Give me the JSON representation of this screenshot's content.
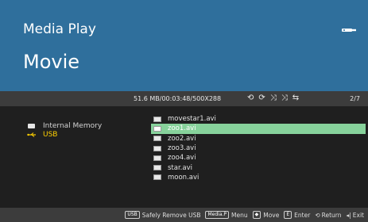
{
  "header": {
    "app_title": "Media Play",
    "section_title": "Movie"
  },
  "infobar": {
    "file_meta": "51.6 MB/00:03:48/500X288",
    "icons": [
      "repeat-one-icon",
      "repeat-all-icon",
      "shuffle-icon",
      "shuffle-all-icon",
      "repeat-off-icon"
    ],
    "page_count": "2/7"
  },
  "devices": [
    {
      "label": "Internal Memory",
      "icon": "memory-icon",
      "selected": false
    },
    {
      "label": "USB",
      "icon": "usb-icon",
      "selected": true
    }
  ],
  "files": [
    {
      "name": "movestar1.avi",
      "selected": false
    },
    {
      "name": "zoo1.avi",
      "selected": true
    },
    {
      "name": "zoo2.avi",
      "selected": false
    },
    {
      "name": "zoo3.avi",
      "selected": false
    },
    {
      "name": "zoo4.avi",
      "selected": false
    },
    {
      "name": "star.avi",
      "selected": false
    },
    {
      "name": "moon.avi",
      "selected": false
    }
  ],
  "footer": {
    "safely_remove": {
      "key": "USB",
      "label": "Safely Remove USB"
    },
    "menu": {
      "key": "Media.P",
      "label": "Menu"
    },
    "move": {
      "key": "◆",
      "label": "Move"
    },
    "enter": {
      "key": "E",
      "label": "Enter"
    },
    "return": {
      "key": "⟲",
      "label": "Return"
    },
    "exit": {
      "key": "◂|",
      "label": "Exit"
    }
  },
  "colors": {
    "header_bg": "#2f6f9c",
    "infobar_bg": "#3c3c3c",
    "content_bg": "#1f1f1f",
    "selected_row": "#87d29b",
    "usb_highlight": "#ffd100"
  }
}
